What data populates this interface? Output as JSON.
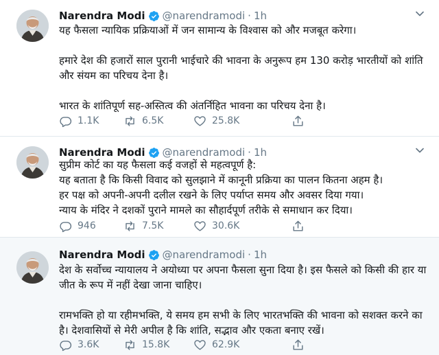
{
  "tweets": [
    {
      "author_name": "Narendra Modi",
      "author_handle": "@narendramodi",
      "separator": "·",
      "time": "1h",
      "paragraphs": [
        "यह फैसला न्यायिक प्रक्रियाओं में जन सामान्य के विश्वास को और मजबूत करेगा।",
        "हमारे देश की हजारों साल पुरानी भाईचारे की भावना के अनुरूप हम 130 करोड़ भारतीयों को शांति और संयम का परिचय देना है।",
        "भारत के शांतिपूर्ण सह-अस्तित्व की अंतर्निहित भावना का परिचय देना है।"
      ],
      "replies": "1.1K",
      "retweets": "6.5K",
      "likes": "25.8K"
    },
    {
      "author_name": "Narendra Modi",
      "author_handle": "@narendramodi",
      "separator": "·",
      "time": "1h",
      "paragraphs": [
        "सुप्रीम कोर्ट का यह फैसला कई वजहों से महत्वपूर्ण है:",
        "यह बताता है कि किसी विवाद को सुलझाने में कानूनी प्रक्रिया का पालन कितना अहम है।",
        "हर पक्ष को अपनी-अपनी दलील रखने के लिए पर्याप्त समय और अवसर दिया गया।",
        "न्याय के मंदिर ने दशकों पुराने मामले का सौहार्दपूर्ण तरीके से समाधान कर दिया।"
      ],
      "replies": "946",
      "retweets": "7.5K",
      "likes": "30.6K"
    },
    {
      "author_name": "Narendra Modi",
      "author_handle": "@narendramodi",
      "separator": "·",
      "time": "1h",
      "paragraphs": [
        "देश के सर्वोच्च न्यायालय ने अयोध्या पर अपना फैसला सुना दिया है। इस फैसले को किसी की हार या जीत के रूप में नहीं देखा जाना चाहिए।",
        "रामभक्ति हो या रहीमभक्ति, ये समय हम सभी के लिए भारतभक्ति की भावना को सशक्त करने का है। देशवासियों से मेरी अपील है कि शांति, सद्भाव और एकता बनाए रखें।"
      ],
      "replies": "3.6K",
      "retweets": "15.8K",
      "likes": "62.9K"
    }
  ],
  "icons": {
    "verified": "verified-badge-icon",
    "reply": "reply-icon",
    "retweet": "retweet-icon",
    "like": "heart-icon",
    "share": "share-icon",
    "menu": "chevron-down-icon"
  },
  "colors": {
    "verified": "#1da1f2",
    "muted": "#657786",
    "text": "#14171a",
    "highlight_bg": "#f5f8fa",
    "divider": "#e1e8ed"
  }
}
